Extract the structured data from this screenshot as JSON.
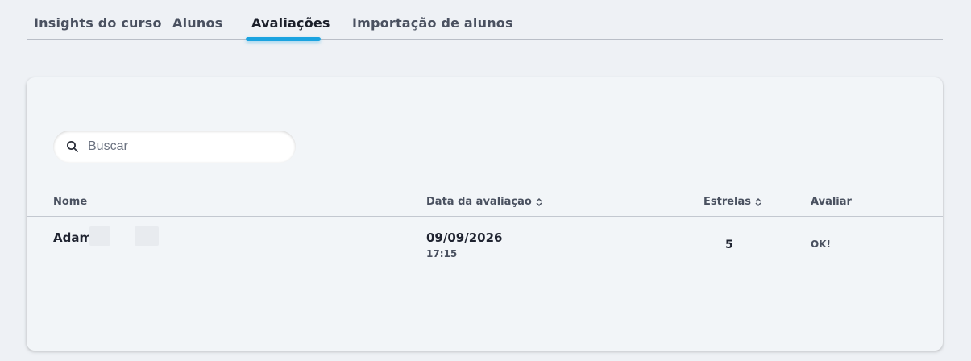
{
  "tabs": [
    {
      "label": "Insights do curso",
      "active": false
    },
    {
      "label": "Alunos",
      "active": false
    },
    {
      "label": "Avaliações",
      "active": true
    },
    {
      "label": "Importação de alunos",
      "active": false
    }
  ],
  "search": {
    "placeholder": "Buscar",
    "value": "",
    "icon": "search-icon"
  },
  "table": {
    "columns": [
      {
        "label": "Nome",
        "sortable": false
      },
      {
        "label": "Data da avaliação",
        "sortable": true
      },
      {
        "label": "Estrelas",
        "sortable": true
      },
      {
        "label": "Avaliar",
        "sortable": false
      }
    ],
    "rows": [
      {
        "name": "Adam",
        "date": "09/09/2026",
        "time": "17:15",
        "stars": "5",
        "rating": "OK!"
      }
    ]
  },
  "colors": {
    "accent": "#1aa3e0",
    "background": "#eef1f5",
    "card": "#f2f5f8"
  }
}
